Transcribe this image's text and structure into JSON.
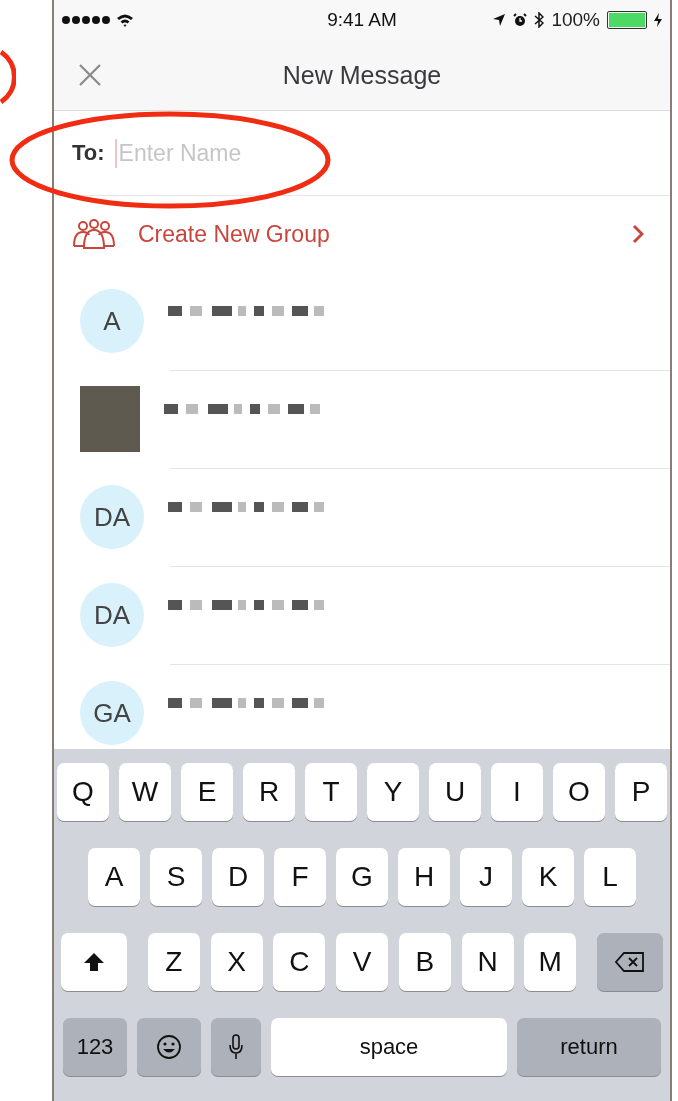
{
  "status_bar": {
    "time": "9:41 AM",
    "battery": "100%"
  },
  "nav": {
    "title": "New Message"
  },
  "to_field": {
    "label": "To:",
    "placeholder": "Enter Name"
  },
  "create_group": {
    "label": "Create New Group"
  },
  "contacts": [
    {
      "kind": "initials",
      "initials": "A"
    },
    {
      "kind": "photo"
    },
    {
      "kind": "initials",
      "initials": "DA"
    },
    {
      "kind": "initials",
      "initials": "DA"
    },
    {
      "kind": "initials",
      "initials": "GA"
    }
  ],
  "keyboard": {
    "letter_rows": [
      [
        {
          "kind": "letter",
          "label": "Q"
        },
        {
          "kind": "letter",
          "label": "W"
        },
        {
          "kind": "letter",
          "label": "E"
        },
        {
          "kind": "letter",
          "label": "R"
        },
        {
          "kind": "letter",
          "label": "T"
        },
        {
          "kind": "letter",
          "label": "Y"
        },
        {
          "kind": "letter",
          "label": "U"
        },
        {
          "kind": "letter",
          "label": "I"
        },
        {
          "kind": "letter",
          "label": "O"
        },
        {
          "kind": "letter",
          "label": "P"
        }
      ],
      [
        {
          "kind": "letter",
          "label": "A"
        },
        {
          "kind": "letter",
          "label": "S"
        },
        {
          "kind": "letter",
          "label": "D"
        },
        {
          "kind": "letter",
          "label": "F"
        },
        {
          "kind": "letter",
          "label": "G"
        },
        {
          "kind": "letter",
          "label": "H"
        },
        {
          "kind": "letter",
          "label": "J"
        },
        {
          "kind": "letter",
          "label": "K"
        },
        {
          "kind": "letter",
          "label": "L"
        }
      ],
      [
        {
          "kind": "shift"
        },
        {
          "kind": "letter",
          "label": "Z"
        },
        {
          "kind": "letter",
          "label": "X"
        },
        {
          "kind": "letter",
          "label": "C"
        },
        {
          "kind": "letter",
          "label": "V"
        },
        {
          "kind": "letter",
          "label": "B"
        },
        {
          "kind": "letter",
          "label": "N"
        },
        {
          "kind": "letter",
          "label": "M"
        },
        {
          "kind": "delete"
        }
      ]
    ],
    "bottom_row": {
      "keys": [
        {
          "kind": "mode",
          "label": "123"
        },
        {
          "kind": "emoji"
        },
        {
          "kind": "mic"
        },
        {
          "kind": "space",
          "label": "space"
        },
        {
          "kind": "return",
          "label": "return"
        }
      ]
    }
  }
}
